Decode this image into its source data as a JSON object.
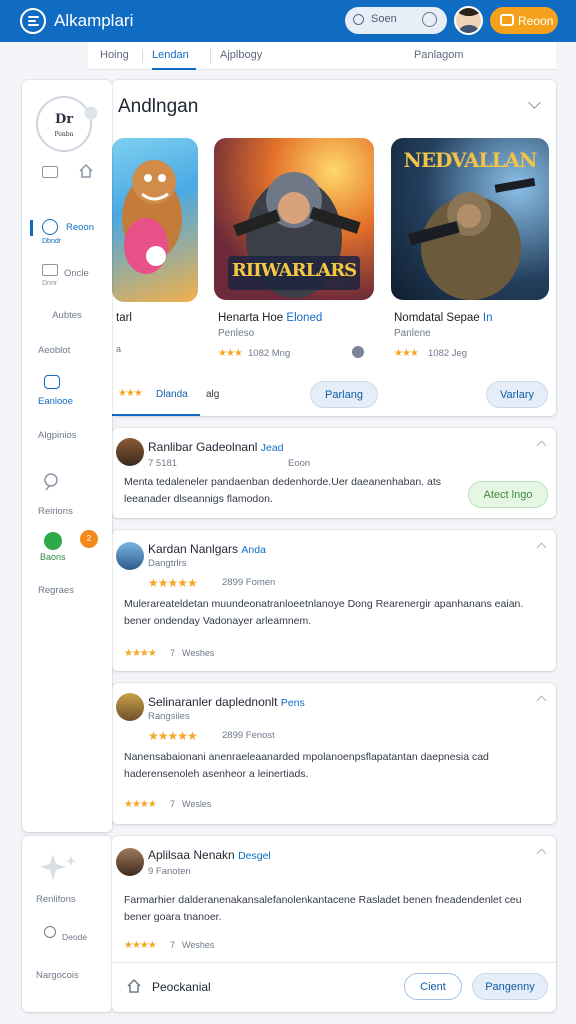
{
  "header": {
    "brand": "Alkamplari",
    "search_label": "Soen",
    "recommend_label": "Reoon"
  },
  "tabs": [
    {
      "label": "Hoing",
      "active": false
    },
    {
      "label": "Lendan",
      "active": true
    },
    {
      "label": "Ajplbogy",
      "active": false
    },
    {
      "label": "Panlagom",
      "active": false
    }
  ],
  "sidebar": {
    "logo_text": "Dr",
    "logo_sub": "Ponbn",
    "items": [
      {
        "label": "Reoon",
        "sub": "Dbndr",
        "active": true
      },
      {
        "label": "Oncle",
        "sub": "Dnnr",
        "active": false
      },
      {
        "label": "Aubtes",
        "active": false
      },
      {
        "label": "Aeoblot",
        "active": false
      },
      {
        "label": "Eanlooe",
        "active": true
      },
      {
        "label": "Algpinios",
        "active": false
      },
      {
        "label": "Reirions",
        "active": false
      },
      {
        "label": "Baons",
        "active": true
      },
      {
        "label": "Regraes",
        "active": false
      }
    ],
    "notify_count": "2",
    "extra": {
      "label": "Renlifons",
      "sub_label": "Deode",
      "bottom": "Nargocois"
    }
  },
  "featured": {
    "title": "Andlngan",
    "games": [
      {
        "title": "tarl",
        "sub": "",
        "meta": "",
        "button": "Dlanda",
        "meta2": "alg",
        "art_text": ""
      },
      {
        "title": "Henarta Hoe",
        "title_b": "Eloned",
        "sub": "Penleso",
        "meta": "1082 Mng",
        "button": "Parlang",
        "art_text": "RIIWARLARS"
      },
      {
        "title": "Nomdatal Sepae",
        "title_b": "In",
        "sub": "Panlene",
        "meta": "1082 Jeg",
        "button": "Varlary",
        "art_text": "NEDVALLAN"
      }
    ]
  },
  "reviews": [
    {
      "name": "Ranlibar Gadeolnanl",
      "tag": "Jead",
      "meta_left": "7 5181",
      "meta_right": "Eoon",
      "text": "Menta tedaleneler pandaenban dedenhorde.Uer daeanenhaban. ats leeanader dlseannigs flamodon.",
      "action": "Atect lngo"
    },
    {
      "name": "Kardan Nanlgars",
      "tag": "Anda",
      "sub": "Dangtrlrs",
      "rating_meta": "2899 Fomen",
      "text": "Mulerareateldetan muundeonatranloeetnlanoye Dong Rearenergir apanhanans eaian. bener ondenday Vadonayer arleamnem.",
      "footer": "Weshes",
      "footer_num": "7"
    },
    {
      "name": "Selinaranler daplednonlt",
      "tag": "Pens",
      "sub": "Rangsiles",
      "rating_meta": "2899 Fenost",
      "text": "Nanensabaionani anenraeleaanarded mpolanoenpsflapatantan daepnesia cad haderensenoleh asenheor a leinertiads.",
      "footer": "Wesles",
      "footer_num": "7"
    },
    {
      "name": "Aplilsaa Nenakn",
      "tag": "Desgel",
      "meta_left": "9 Fanoten",
      "text": "Farmarhier dalderanenakansalefanolenkantacene Rasladet benen fneadendenlet ceu bener goara tnanoer.",
      "footer": "Weshes",
      "footer_num": "7",
      "bottom_label": "Peockanial",
      "btn_outline": "Cient",
      "btn_blue": "Pangenny"
    }
  ],
  "colors": {
    "accent": "#0f6cc2",
    "warning": "#f5a11b",
    "success": "#3c8c37"
  }
}
